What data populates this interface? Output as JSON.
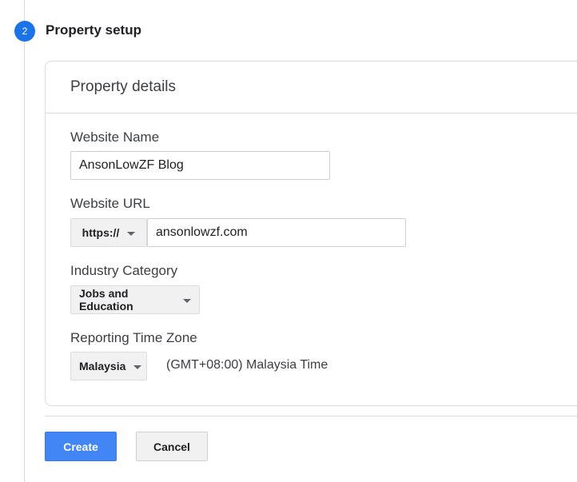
{
  "step": {
    "number": "2",
    "title": "Property setup"
  },
  "card": {
    "header": "Property details"
  },
  "fields": {
    "website_name": {
      "label": "Website Name",
      "value": "AnsonLowZF Blog"
    },
    "website_url": {
      "label": "Website URL",
      "protocol": "https://",
      "value": "ansonlowzf.com"
    },
    "industry": {
      "label": "Industry Category",
      "selected": "Jobs and Education"
    },
    "timezone": {
      "label": "Reporting Time Zone",
      "country": "Malaysia",
      "zone_text": "(GMT+08:00) Malaysia Time"
    }
  },
  "actions": {
    "create_label": "Create",
    "cancel_label": "Cancel"
  },
  "colors": {
    "accent": "#1a73e8",
    "primary_button": "#4285f4",
    "secondary_button": "#f1f1f1"
  },
  "icons": {
    "dropdown": "chevron-down-icon"
  }
}
